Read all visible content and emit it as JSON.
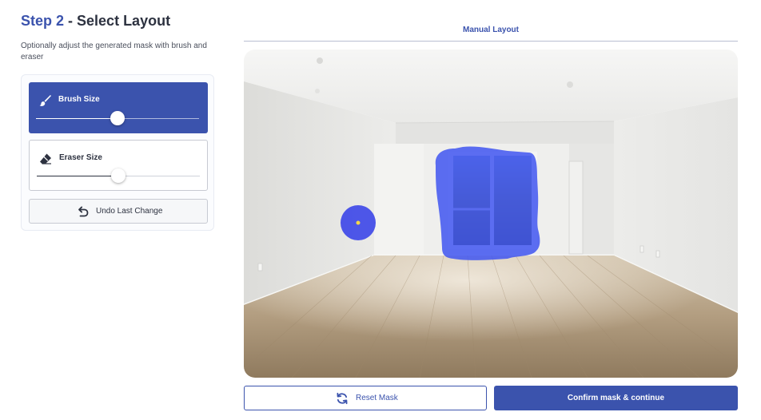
{
  "header": {
    "step_label": "Step 2",
    "separator": " - ",
    "title": "Select Layout",
    "subtitle": "Optionally adjust the generated mask with brush and eraser"
  },
  "tools": {
    "brush": {
      "label": "Brush Size",
      "icon": "brush-icon",
      "active": true,
      "value_percent": 50
    },
    "eraser": {
      "label": "Eraser Size",
      "icon": "eraser-icon",
      "active": false,
      "value_percent": 50
    },
    "undo": {
      "label": "Undo Last Change",
      "icon": "undo-icon"
    }
  },
  "canvas": {
    "title": "Manual Layout",
    "mask_color": "#3f55f0"
  },
  "actions": {
    "reset": {
      "label": "Reset Mask",
      "icon": "refresh-icon"
    },
    "confirm": {
      "label": "Confirm mask & continue"
    }
  },
  "colors": {
    "primary": "#3b53ad",
    "border": "#c7cad2"
  }
}
